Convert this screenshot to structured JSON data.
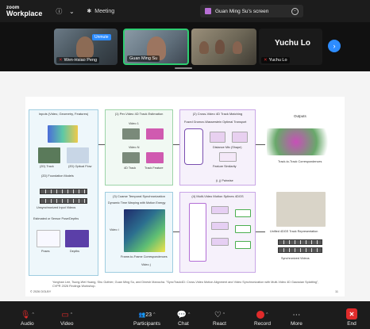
{
  "window": {
    "brand_top": "zoom",
    "brand_bottom": "Workplace",
    "meeting_label": "Meeting",
    "share_label": "Guan Ming Su's screen"
  },
  "participants": [
    {
      "name": "Wen-Hsiao Peng",
      "badge": "Unmute",
      "muted": true
    },
    {
      "name": "Guan Ming Su",
      "muted": false,
      "active": true
    },
    {
      "name": "",
      "muted": false
    },
    {
      "name": "Yuchu Lo",
      "big_name": "Yuchu Lo",
      "muted": true
    }
  ],
  "slide": {
    "s1_title": "Inputs (Video, Geometry, Features)",
    "s1_a": "(2D) Track",
    "s1_b": "(2D) Optical Flow",
    "s1_c": "(2D) Foundation Models",
    "s1_d": "Unsynchronized Input Videos",
    "s1_e": "Estimated or Sensor Pose/Depths",
    "s1_f": "Poses",
    "s1_g": "Depths",
    "s2_title": "(1) Per-Video 4D Track Estimation",
    "s2_a": "Video 1",
    "s2_b": "Video N",
    "s2_c": "4D Track",
    "s2_d": "Track Feature",
    "s3_title": "(2) Cross-Video 4D Track Matching",
    "s3_a": "Fused Gromov-Wasserstein Optimal Transport",
    "s3_b": "Distance Mtx (Shape)",
    "s3_c": "Feature Similarity",
    "s3_d": "(i, j) Pairwise",
    "s4_title": "Outputs",
    "s4_a": "Track-to-Track Correspondences",
    "s4_b": "Unified 4DGS Track Representation",
    "s4_c": "Synchronized Videos",
    "s5_title": "(3) Coarse Temporal Synchronization",
    "s5_a": "Dynamic Time Warping with Motion Energy",
    "s5_b": "Frame-to-Frame Correspondences",
    "s5_c": "Video i",
    "s5_d": "Video j",
    "s6_title": "(4) Multi-Video Motion Splines 4DGS",
    "footer": "Yonghan Lee, Tsung-Wei Huang, Shu Guthier, Guan Ming Su, and Dinesh Manocha. \"SyncTrack4D: Cross-Video Motion Alignment and Video Synchronization with Multi-Video 4D Gaussian Splatting\", CVPR 2026 Findings Workshop.",
    "copyright": "© 2026 DOLBY",
    "page": "11"
  },
  "toolbar": {
    "audio": "Audio",
    "video": "Video",
    "participants": "Participants",
    "participant_count": "23",
    "chat": "Chat",
    "react": "React",
    "record": "Record",
    "more": "More",
    "end": "End"
  }
}
